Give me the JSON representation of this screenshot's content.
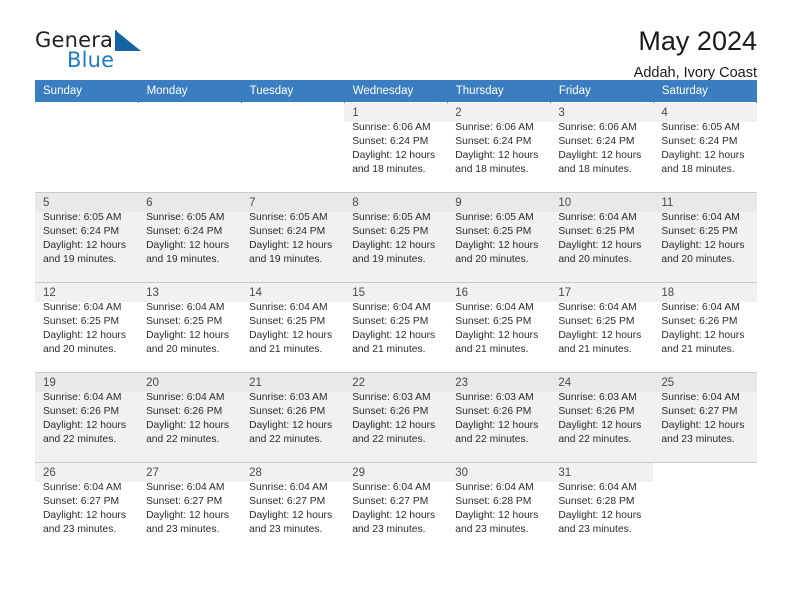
{
  "brand": {
    "name_part1": "General",
    "name_part2": "Blue",
    "triangle_color": "#1464a5",
    "blue_color": "#1d7cc4"
  },
  "header": {
    "title": "May 2024",
    "subtitle": "Addah, Ivory Coast",
    "header_bg": "#3a7dc0"
  },
  "weekdays": [
    "Sunday",
    "Monday",
    "Tuesday",
    "Wednesday",
    "Thursday",
    "Friday",
    "Saturday"
  ],
  "labels": {
    "sunrise_prefix": "Sunrise: ",
    "sunset_prefix": "Sunset: ",
    "daylight_prefix": "Daylight: "
  },
  "weeks": [
    {
      "shaded": false,
      "days": [
        {
          "day": "",
          "empty": true
        },
        {
          "day": "",
          "empty": true
        },
        {
          "day": "",
          "empty": true
        },
        {
          "day": "1",
          "sunrise": "Sunrise: 6:06 AM",
          "sunset": "Sunset: 6:24 PM",
          "daylight_1": "Daylight: 12 hours",
          "daylight_2": "and 18 minutes."
        },
        {
          "day": "2",
          "sunrise": "Sunrise: 6:06 AM",
          "sunset": "Sunset: 6:24 PM",
          "daylight_1": "Daylight: 12 hours",
          "daylight_2": "and 18 minutes."
        },
        {
          "day": "3",
          "sunrise": "Sunrise: 6:06 AM",
          "sunset": "Sunset: 6:24 PM",
          "daylight_1": "Daylight: 12 hours",
          "daylight_2": "and 18 minutes."
        },
        {
          "day": "4",
          "sunrise": "Sunrise: 6:05 AM",
          "sunset": "Sunset: 6:24 PM",
          "daylight_1": "Daylight: 12 hours",
          "daylight_2": "and 18 minutes."
        }
      ]
    },
    {
      "shaded": true,
      "days": [
        {
          "day": "5",
          "sunrise": "Sunrise: 6:05 AM",
          "sunset": "Sunset: 6:24 PM",
          "daylight_1": "Daylight: 12 hours",
          "daylight_2": "and 19 minutes."
        },
        {
          "day": "6",
          "sunrise": "Sunrise: 6:05 AM",
          "sunset": "Sunset: 6:24 PM",
          "daylight_1": "Daylight: 12 hours",
          "daylight_2": "and 19 minutes."
        },
        {
          "day": "7",
          "sunrise": "Sunrise: 6:05 AM",
          "sunset": "Sunset: 6:24 PM",
          "daylight_1": "Daylight: 12 hours",
          "daylight_2": "and 19 minutes."
        },
        {
          "day": "8",
          "sunrise": "Sunrise: 6:05 AM",
          "sunset": "Sunset: 6:25 PM",
          "daylight_1": "Daylight: 12 hours",
          "daylight_2": "and 19 minutes."
        },
        {
          "day": "9",
          "sunrise": "Sunrise: 6:05 AM",
          "sunset": "Sunset: 6:25 PM",
          "daylight_1": "Daylight: 12 hours",
          "daylight_2": "and 20 minutes."
        },
        {
          "day": "10",
          "sunrise": "Sunrise: 6:04 AM",
          "sunset": "Sunset: 6:25 PM",
          "daylight_1": "Daylight: 12 hours",
          "daylight_2": "and 20 minutes."
        },
        {
          "day": "11",
          "sunrise": "Sunrise: 6:04 AM",
          "sunset": "Sunset: 6:25 PM",
          "daylight_1": "Daylight: 12 hours",
          "daylight_2": "and 20 minutes."
        }
      ]
    },
    {
      "shaded": false,
      "days": [
        {
          "day": "12",
          "sunrise": "Sunrise: 6:04 AM",
          "sunset": "Sunset: 6:25 PM",
          "daylight_1": "Daylight: 12 hours",
          "daylight_2": "and 20 minutes."
        },
        {
          "day": "13",
          "sunrise": "Sunrise: 6:04 AM",
          "sunset": "Sunset: 6:25 PM",
          "daylight_1": "Daylight: 12 hours",
          "daylight_2": "and 20 minutes."
        },
        {
          "day": "14",
          "sunrise": "Sunrise: 6:04 AM",
          "sunset": "Sunset: 6:25 PM",
          "daylight_1": "Daylight: 12 hours",
          "daylight_2": "and 21 minutes."
        },
        {
          "day": "15",
          "sunrise": "Sunrise: 6:04 AM",
          "sunset": "Sunset: 6:25 PM",
          "daylight_1": "Daylight: 12 hours",
          "daylight_2": "and 21 minutes."
        },
        {
          "day": "16",
          "sunrise": "Sunrise: 6:04 AM",
          "sunset": "Sunset: 6:25 PM",
          "daylight_1": "Daylight: 12 hours",
          "daylight_2": "and 21 minutes."
        },
        {
          "day": "17",
          "sunrise": "Sunrise: 6:04 AM",
          "sunset": "Sunset: 6:25 PM",
          "daylight_1": "Daylight: 12 hours",
          "daylight_2": "and 21 minutes."
        },
        {
          "day": "18",
          "sunrise": "Sunrise: 6:04 AM",
          "sunset": "Sunset: 6:26 PM",
          "daylight_1": "Daylight: 12 hours",
          "daylight_2": "and 21 minutes."
        }
      ]
    },
    {
      "shaded": true,
      "days": [
        {
          "day": "19",
          "sunrise": "Sunrise: 6:04 AM",
          "sunset": "Sunset: 6:26 PM",
          "daylight_1": "Daylight: 12 hours",
          "daylight_2": "and 22 minutes."
        },
        {
          "day": "20",
          "sunrise": "Sunrise: 6:04 AM",
          "sunset": "Sunset: 6:26 PM",
          "daylight_1": "Daylight: 12 hours",
          "daylight_2": "and 22 minutes."
        },
        {
          "day": "21",
          "sunrise": "Sunrise: 6:03 AM",
          "sunset": "Sunset: 6:26 PM",
          "daylight_1": "Daylight: 12 hours",
          "daylight_2": "and 22 minutes."
        },
        {
          "day": "22",
          "sunrise": "Sunrise: 6:03 AM",
          "sunset": "Sunset: 6:26 PM",
          "daylight_1": "Daylight: 12 hours",
          "daylight_2": "and 22 minutes."
        },
        {
          "day": "23",
          "sunrise": "Sunrise: 6:03 AM",
          "sunset": "Sunset: 6:26 PM",
          "daylight_1": "Daylight: 12 hours",
          "daylight_2": "and 22 minutes."
        },
        {
          "day": "24",
          "sunrise": "Sunrise: 6:03 AM",
          "sunset": "Sunset: 6:26 PM",
          "daylight_1": "Daylight: 12 hours",
          "daylight_2": "and 22 minutes."
        },
        {
          "day": "25",
          "sunrise": "Sunrise: 6:04 AM",
          "sunset": "Sunset: 6:27 PM",
          "daylight_1": "Daylight: 12 hours",
          "daylight_2": "and 23 minutes."
        }
      ]
    },
    {
      "shaded": false,
      "days": [
        {
          "day": "26",
          "sunrise": "Sunrise: 6:04 AM",
          "sunset": "Sunset: 6:27 PM",
          "daylight_1": "Daylight: 12 hours",
          "daylight_2": "and 23 minutes."
        },
        {
          "day": "27",
          "sunrise": "Sunrise: 6:04 AM",
          "sunset": "Sunset: 6:27 PM",
          "daylight_1": "Daylight: 12 hours",
          "daylight_2": "and 23 minutes."
        },
        {
          "day": "28",
          "sunrise": "Sunrise: 6:04 AM",
          "sunset": "Sunset: 6:27 PM",
          "daylight_1": "Daylight: 12 hours",
          "daylight_2": "and 23 minutes."
        },
        {
          "day": "29",
          "sunrise": "Sunrise: 6:04 AM",
          "sunset": "Sunset: 6:27 PM",
          "daylight_1": "Daylight: 12 hours",
          "daylight_2": "and 23 minutes."
        },
        {
          "day": "30",
          "sunrise": "Sunrise: 6:04 AM",
          "sunset": "Sunset: 6:28 PM",
          "daylight_1": "Daylight: 12 hours",
          "daylight_2": "and 23 minutes."
        },
        {
          "day": "31",
          "sunrise": "Sunrise: 6:04 AM",
          "sunset": "Sunset: 6:28 PM",
          "daylight_1": "Daylight: 12 hours",
          "daylight_2": "and 23 minutes."
        },
        {
          "day": "",
          "empty": true
        }
      ]
    }
  ]
}
